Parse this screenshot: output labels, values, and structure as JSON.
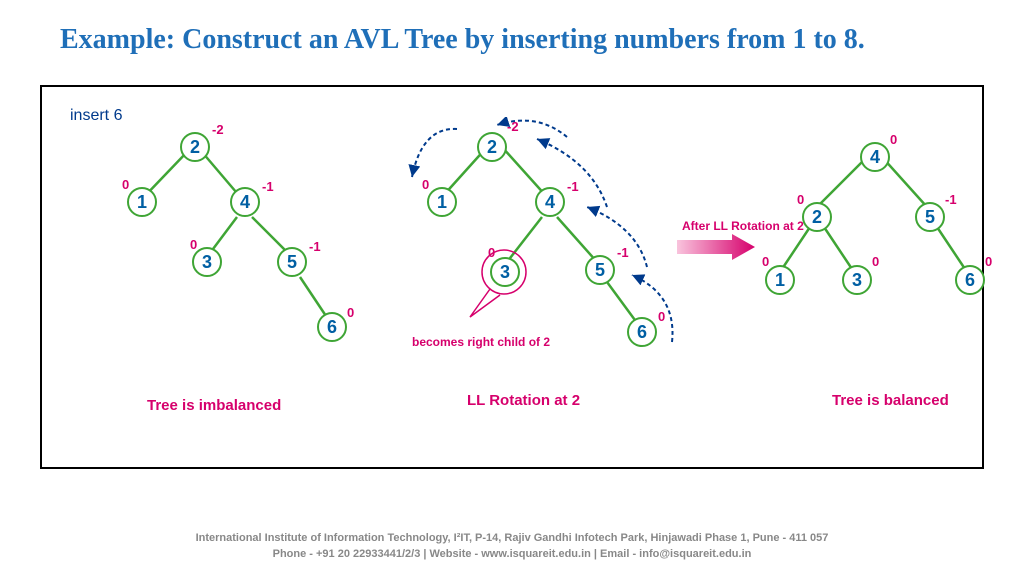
{
  "title": "Example: Construct an AVL Tree by inserting numbers from 1 to 8.",
  "insert_label": "insert 6",
  "tree1": {
    "caption": "Tree is imbalanced",
    "nodes": {
      "n2": {
        "v": "2",
        "bf": "-2"
      },
      "n1": {
        "v": "1",
        "bf": "0"
      },
      "n4": {
        "v": "4",
        "bf": "-1"
      },
      "n3": {
        "v": "3",
        "bf": "0"
      },
      "n5": {
        "v": "5",
        "bf": "-1"
      },
      "n6": {
        "v": "6",
        "bf": "0"
      }
    }
  },
  "tree2": {
    "caption": "LL Rotation at 2",
    "annotation": "becomes right child of 2",
    "rotation_label": "After LL Rotation at 2",
    "nodes": {
      "n2": {
        "v": "2",
        "bf": "-2"
      },
      "n1": {
        "v": "1",
        "bf": "0"
      },
      "n4": {
        "v": "4",
        "bf": "-1"
      },
      "n3": {
        "v": "3",
        "bf": "0"
      },
      "n5": {
        "v": "5",
        "bf": "-1"
      },
      "n6": {
        "v": "6",
        "bf": "0"
      }
    }
  },
  "tree3": {
    "caption": "Tree is balanced",
    "nodes": {
      "n4": {
        "v": "4",
        "bf": "0"
      },
      "n2": {
        "v": "2",
        "bf": "0"
      },
      "n5": {
        "v": "5",
        "bf": "-1"
      },
      "n1": {
        "v": "1",
        "bf": "0"
      },
      "n3": {
        "v": "3",
        "bf": "0"
      },
      "n6": {
        "v": "6",
        "bf": "0"
      }
    }
  },
  "footer": {
    "line1": "International Institute of Information Technology, I²IT, P-14, Rajiv Gandhi Infotech Park, Hinjawadi Phase 1, Pune - 411 057",
    "line2": "Phone - +91 20 22933441/2/3 | Website - www.isquareit.edu.in | Email - info@isquareit.edu.in"
  },
  "chart_data": {
    "type": "diagram",
    "description": "AVL tree construction inserting 6, showing imbalanced tree, LL rotation at node 2, and resulting balanced tree",
    "trees": [
      {
        "label": "Tree is imbalanced",
        "edges": [
          [
            "2",
            "1"
          ],
          [
            "2",
            "4"
          ],
          [
            "4",
            "3"
          ],
          [
            "4",
            "5"
          ],
          [
            "5",
            "6"
          ]
        ],
        "balance_factors": {
          "2": -2,
          "1": 0,
          "4": -1,
          "3": 0,
          "5": -1,
          "6": 0
        }
      },
      {
        "label": "LL Rotation at 2",
        "edges": [
          [
            "2",
            "1"
          ],
          [
            "2",
            "4"
          ],
          [
            "4",
            "3"
          ],
          [
            "4",
            "5"
          ],
          [
            "5",
            "6"
          ]
        ],
        "balance_factors": {
          "2": -2,
          "1": 0,
          "4": -1,
          "3": 0,
          "5": -1,
          "6": 0
        },
        "annotation": "3 becomes right child of 2"
      },
      {
        "label": "Tree is balanced",
        "edges": [
          [
            "4",
            "2"
          ],
          [
            "4",
            "5"
          ],
          [
            "2",
            "1"
          ],
          [
            "2",
            "3"
          ],
          [
            "5",
            "6"
          ]
        ],
        "balance_factors": {
          "4": 0,
          "2": 0,
          "5": -1,
          "1": 0,
          "3": 0,
          "6": 0
        }
      }
    ]
  }
}
